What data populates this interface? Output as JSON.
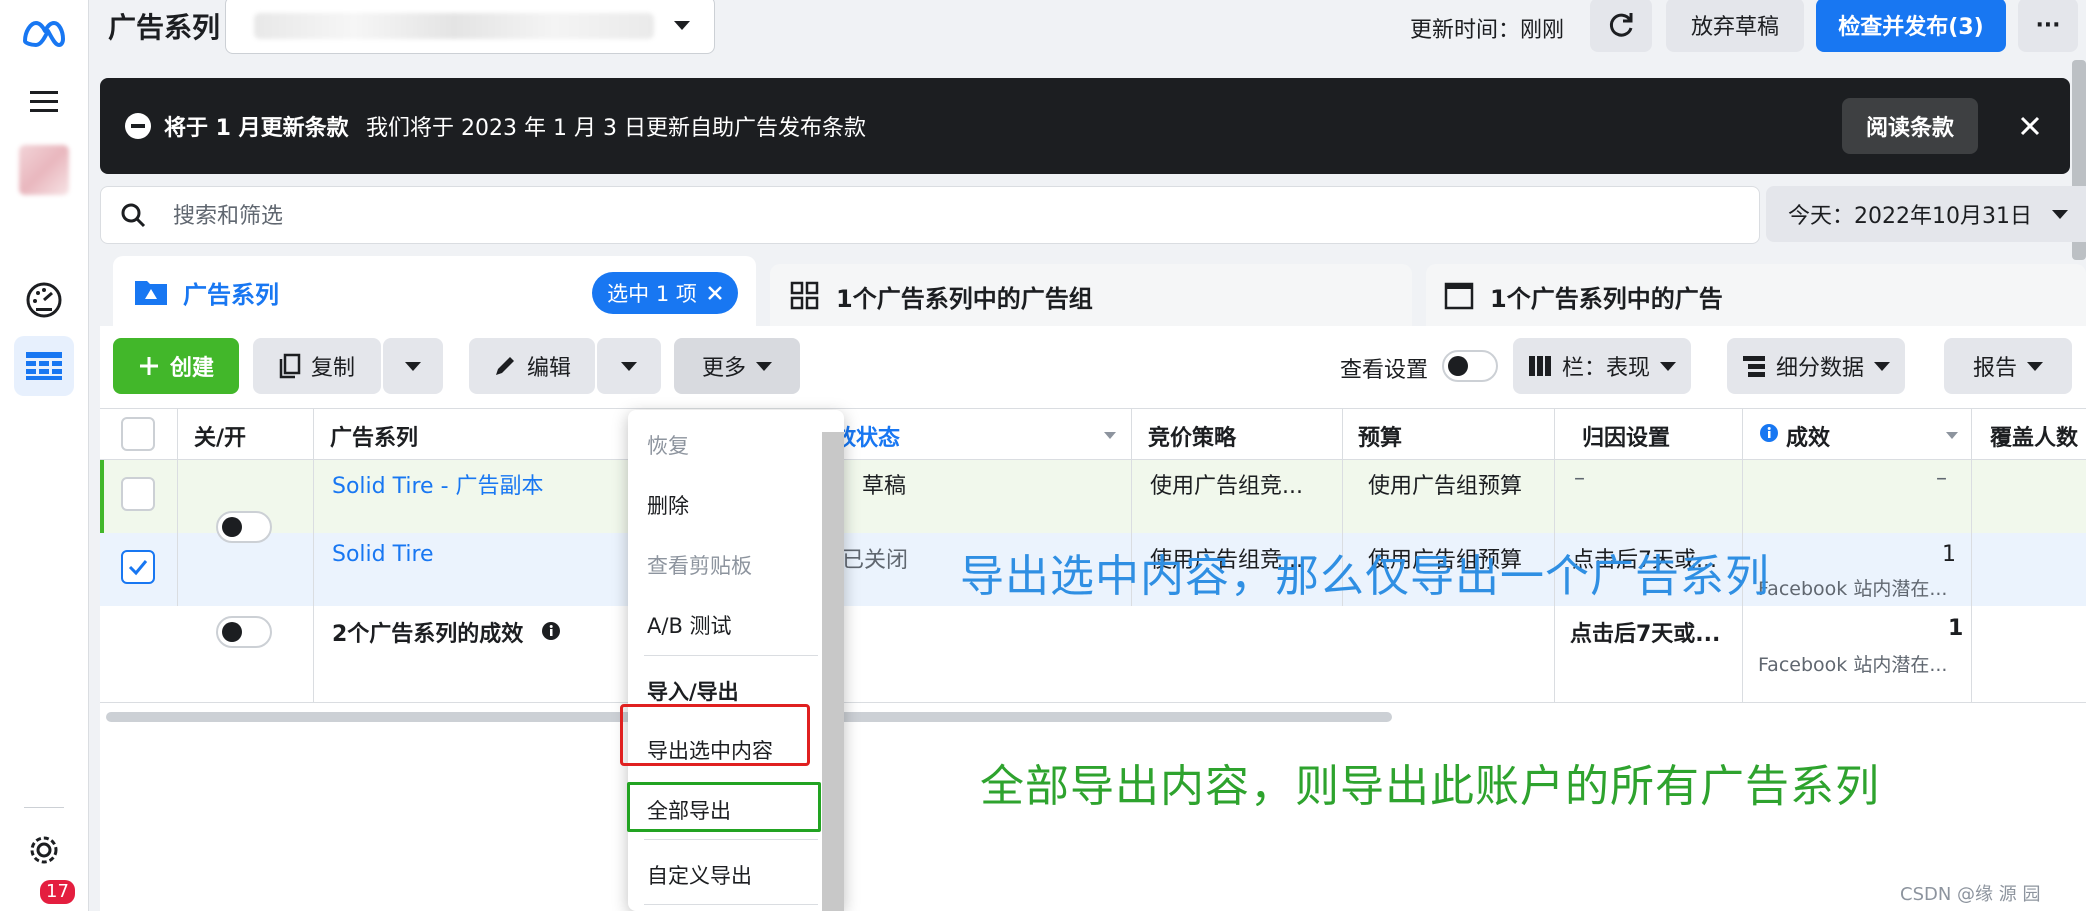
{
  "header": {
    "title": "广告系列",
    "update_time": "更新时间：刚刚",
    "discard_label": "放弃草稿",
    "publish_label": "检查并发布(3)",
    "more_label": "···"
  },
  "notice": {
    "title": "将于 1 月更新条款",
    "text": "我们将于 2023 年 1 月 3 日更新自助广告发布条款",
    "read_label": "阅读条款"
  },
  "search": {
    "placeholder": "搜索和筛选",
    "date_label": "今天：2022年10月31日"
  },
  "tabs": [
    {
      "label": "广告系列",
      "selected_label": "选中 1 项"
    },
    {
      "label": "1个广告系列中的广告组"
    },
    {
      "label": "1个广告系列中的广告"
    }
  ],
  "toolbar": {
    "create_label": "创建",
    "copy_label": "复制",
    "edit_label": "编辑",
    "more_label": "更多",
    "view_settings_label": "查看设置",
    "columns_label": "栏：表现",
    "breakdown_label": "细分数据",
    "report_label": "报告"
  },
  "table": {
    "headers": [
      "关/开",
      "广告系列",
      "投放状态↑",
      "竞价策略",
      "预算",
      "归因设置",
      "成效",
      "覆盖人数"
    ],
    "rows": [
      {
        "name": "Solid Tire - 广告副本",
        "status": "草稿",
        "bid": "使用广告组竞...",
        "budget": "使用广告组预算",
        "attribution": "–",
        "result": "–",
        "result_sub": ""
      },
      {
        "name": "Solid Tire",
        "status": "已关闭",
        "bid": "使用广告组竞...",
        "budget": "使用广告组预算",
        "attribution": "点击后7天或...",
        "result": "1",
        "result_sub": "Facebook 站内潜在..."
      }
    ],
    "summary": {
      "label": "2个广告系列的成效",
      "attribution": "点击后7天或...",
      "result": "1",
      "result_sub": "Facebook 站内潜在..."
    }
  },
  "menu": {
    "items": [
      "恢复",
      "删除",
      "查看剪贴板",
      "A/B 测试"
    ],
    "section_title": "导入/导出",
    "export_selected": "导出选中内容",
    "export_all": "全部导出",
    "custom_export": "自定义导出"
  },
  "annotations": {
    "blue": "导出选中内容，那么仅导出一个广告系列",
    "green": "全部导出内容，则导出此账户的所有广告系列"
  },
  "sidebar": {
    "notification_count": "17"
  },
  "watermark": "CSDN @缘 源 园",
  "colors": {
    "brand_blue": "#1877f2",
    "create_green": "#42b72a",
    "highlight_red": "#e02020",
    "highlight_green": "#22a322"
  }
}
